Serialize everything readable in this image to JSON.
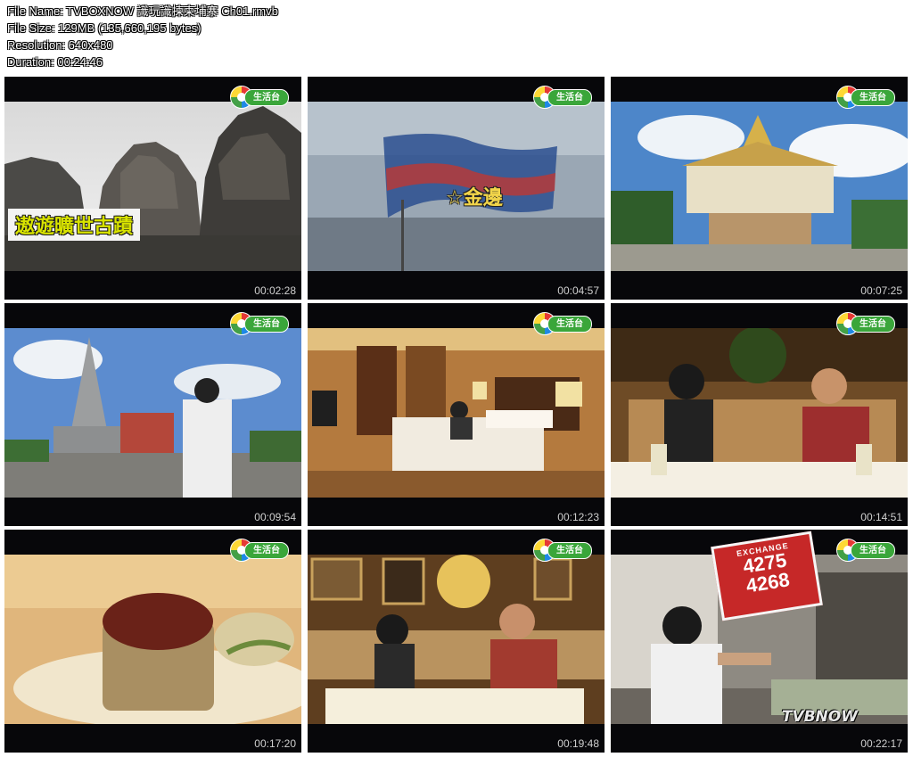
{
  "info": {
    "file_name": "File Name: TVBOXNOW 識玩識揀柬埔寨 Ch01.rmvb",
    "file_size": "File Size: 129MB (135,660,195 bytes)",
    "resolution": "Resolution: 640x480",
    "duration": "Duration: 00:24:46"
  },
  "channel_logo": {
    "label": "生活台",
    "icon": "tvb-life-channel-logo"
  },
  "thumbnails": [
    {
      "timestamp": "00:02:28",
      "caption": "遨遊曠世古蹟"
    },
    {
      "timestamp": "00:04:57",
      "caption": "☆金邊"
    },
    {
      "timestamp": "00:07:25"
    },
    {
      "timestamp": "00:09:54"
    },
    {
      "timestamp": "00:12:23"
    },
    {
      "timestamp": "00:14:51"
    },
    {
      "timestamp": "00:17:20"
    },
    {
      "timestamp": "00:19:48"
    },
    {
      "timestamp": "00:22:17",
      "sign_heading": "EXCHANGE",
      "sign_rate_1": "4275",
      "sign_rate_2": "4268",
      "watermark": "TVBNOW"
    }
  ],
  "colors": {
    "caption_yellow": "#d8e300",
    "exchange_sign": "#c62828",
    "logo_green": "#3aa63a"
  }
}
